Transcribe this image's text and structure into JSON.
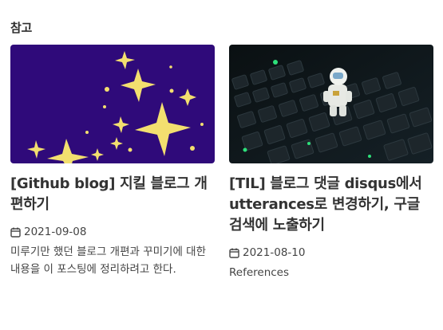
{
  "section": {
    "title": "참고"
  },
  "posts": [
    {
      "title": "[Github blog] 지킬 블로그 개편하기",
      "date": "2021-09-08",
      "excerpt": "미루기만 했던 블로그 개편과 꾸미기에 대한 내용을 이 포스팅에 정리하려고 한다.",
      "thumb_bg": "#2f0a7a",
      "thumb_accent": "#f3df6f"
    },
    {
      "title": "[TIL] 블로그 댓글 disqus에서 utterances로 변경하기, 구글 검색에 노출하기",
      "date": "2021-08-10",
      "excerpt": "References",
      "thumb_bg": "#0c1214",
      "thumb_accent": "#2de07a"
    }
  ],
  "icons": {
    "date": "calendar-icon"
  }
}
